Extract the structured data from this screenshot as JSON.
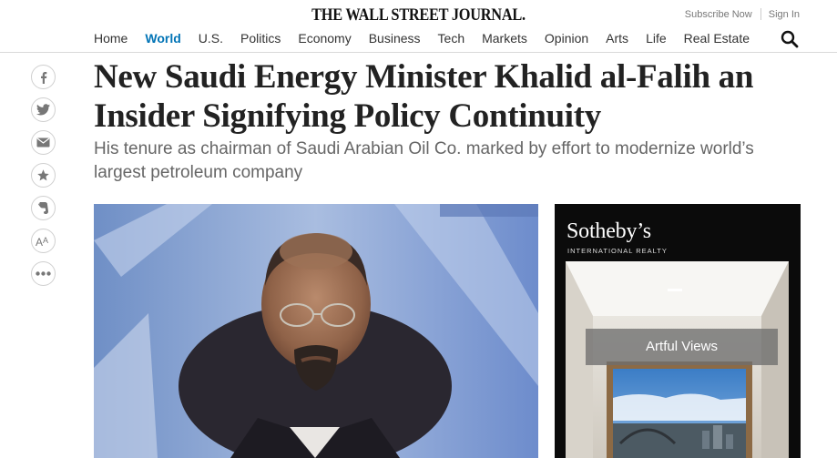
{
  "header": {
    "logo": "THE WALL STREET JOURNAL.",
    "subscribe": "Subscribe Now",
    "signin": "Sign In",
    "nav": [
      "Home",
      "World",
      "U.S.",
      "Politics",
      "Economy",
      "Business",
      "Tech",
      "Markets",
      "Opinion",
      "Arts",
      "Life",
      "Real Estate"
    ],
    "active_nav": "World",
    "search_icon": "search-icon"
  },
  "share_icons": [
    "facebook-icon",
    "twitter-icon",
    "email-icon",
    "bookmark-star-icon",
    "evernote-icon",
    "text-size-icon",
    "more-icon"
  ],
  "article": {
    "headline": "New Saudi Energy Minister Khalid al-Falih an Insider Signifying Policy Continuity",
    "dek": "His tenure as chairman of Saudi Arabian Oil Co. marked by effort to modernize world’s largest petroleum company"
  },
  "ad": {
    "brand": "Sotheby’s",
    "tagline": "INTERNATIONAL REALTY",
    "caption": "Artful Views"
  },
  "colors": {
    "accent": "#0274b6",
    "text": "#222222",
    "dek": "#666666",
    "ad_background": "#0b0b0b"
  }
}
